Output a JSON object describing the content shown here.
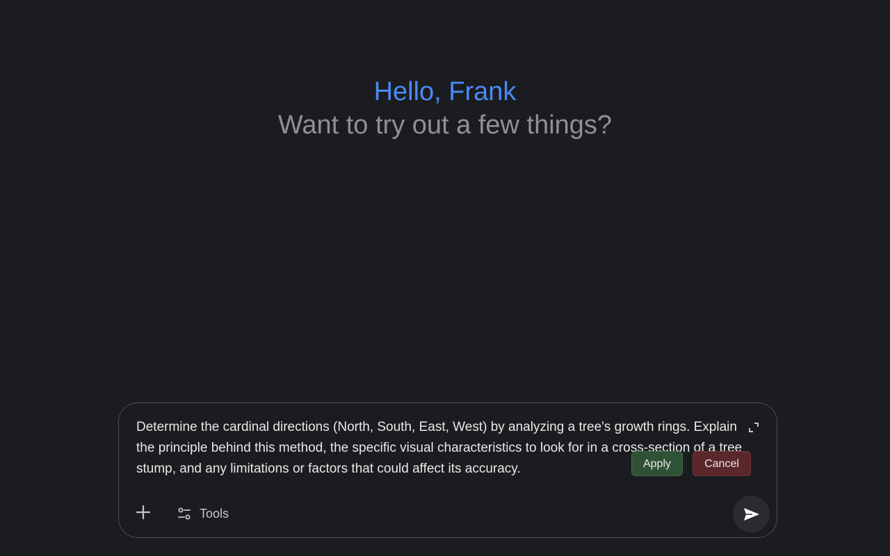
{
  "greeting": {
    "hello": "Hello, Frank",
    "subtitle": "Want to try out a few things?"
  },
  "composer": {
    "prompt_text": "Determine the cardinal directions (North, South, East, West) by analyzing a tree's growth rings. Explain the principle behind this method, the specific visual characteristics to look for in a cross-section of a tree stump, and any limitations or factors that could affect its accuracy.",
    "apply_label": "Apply",
    "cancel_label": "Cancel",
    "tools_label": "Tools",
    "icons": {
      "expand": "expand-icon",
      "add": "plus-icon",
      "tools": "tools-sliders-icon",
      "send": "send-icon"
    }
  },
  "colors": {
    "background": "#1b1c1f",
    "greeting_accent": "#4a8af4",
    "subtitle_gray": "#8e9094",
    "apply_green": "#2f5237",
    "cancel_red": "#5a272b"
  }
}
